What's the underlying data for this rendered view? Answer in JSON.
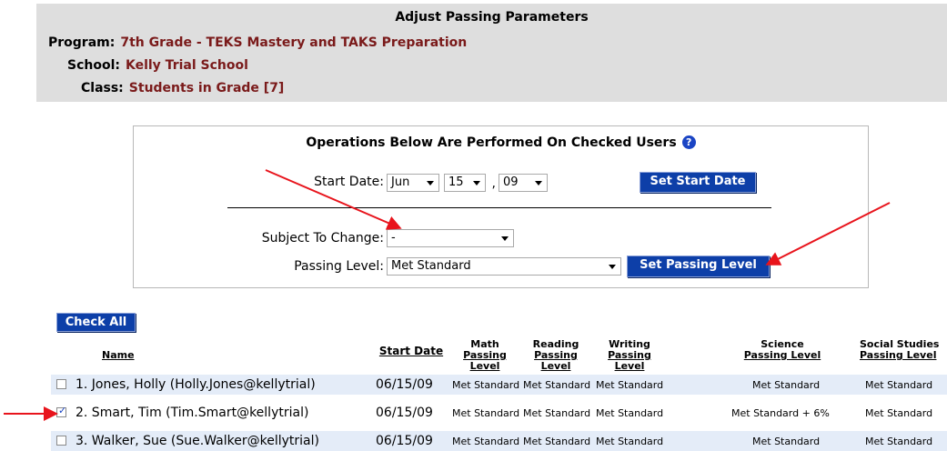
{
  "header": {
    "title": "Adjust Passing Parameters",
    "program_label": "Program:",
    "program_value": "7th Grade - TEKS Mastery and TAKS Preparation",
    "school_label": "School:",
    "school_value": "Kelly Trial School",
    "class_label": "Class:",
    "class_value": "Students in Grade [7]"
  },
  "operations": {
    "title": "Operations Below Are Performed On Checked Users",
    "help_icon": "question-circle-icon",
    "start_date_label": "Start Date:",
    "month": "Jun",
    "day": "15",
    "comma": ",",
    "year": "09",
    "set_start_date_button": "Set Start Date",
    "subject_label": "Subject To Change:",
    "subject_value": "-",
    "passing_level_label": "Passing Level:",
    "passing_level_value": "Met Standard",
    "set_passing_level_button": "Set Passing Level"
  },
  "table": {
    "check_all_button": "Check All",
    "headers": {
      "name": "Name",
      "start_date": "Start Date",
      "math_top": "Math",
      "math_bottom": "Passing Level",
      "reading_top": "Reading",
      "reading_bottom": "Passing Level",
      "writing_top": "Writing",
      "writing_bottom": "Passing Level",
      "science_top": "Science",
      "science_bottom": "Passing Level",
      "social_top": "Social Studies",
      "social_bottom": "Passing Level"
    },
    "rows": [
      {
        "checked": false,
        "name": "1. Jones, Holly (Holly.Jones@kellytrial)",
        "start_date": "06/15/09",
        "math": "Met Standard",
        "reading": "Met Standard",
        "writing": "Met Standard",
        "science": "Met Standard",
        "social": "Met Standard"
      },
      {
        "checked": true,
        "name": "2. Smart, Tim (Tim.Smart@kellytrial)",
        "start_date": "06/15/09",
        "math": "Met Standard",
        "reading": "Met Standard",
        "writing": "Met Standard",
        "science": "Met Standard + 6%",
        "social": "Met Standard"
      },
      {
        "checked": false,
        "name": "3. Walker, Sue (Sue.Walker@kellytrial)",
        "start_date": "06/15/09",
        "math": "Met Standard",
        "reading": "Met Standard",
        "writing": "Met Standard",
        "science": "Met Standard",
        "social": "Met Standard"
      }
    ]
  },
  "colors": {
    "header_bg": "#dedede",
    "value_red": "#7a1a1a",
    "button_blue": "#0d3fa8",
    "row_alt": "#e4ecf8",
    "annotation_arrow": "#e8141c"
  }
}
